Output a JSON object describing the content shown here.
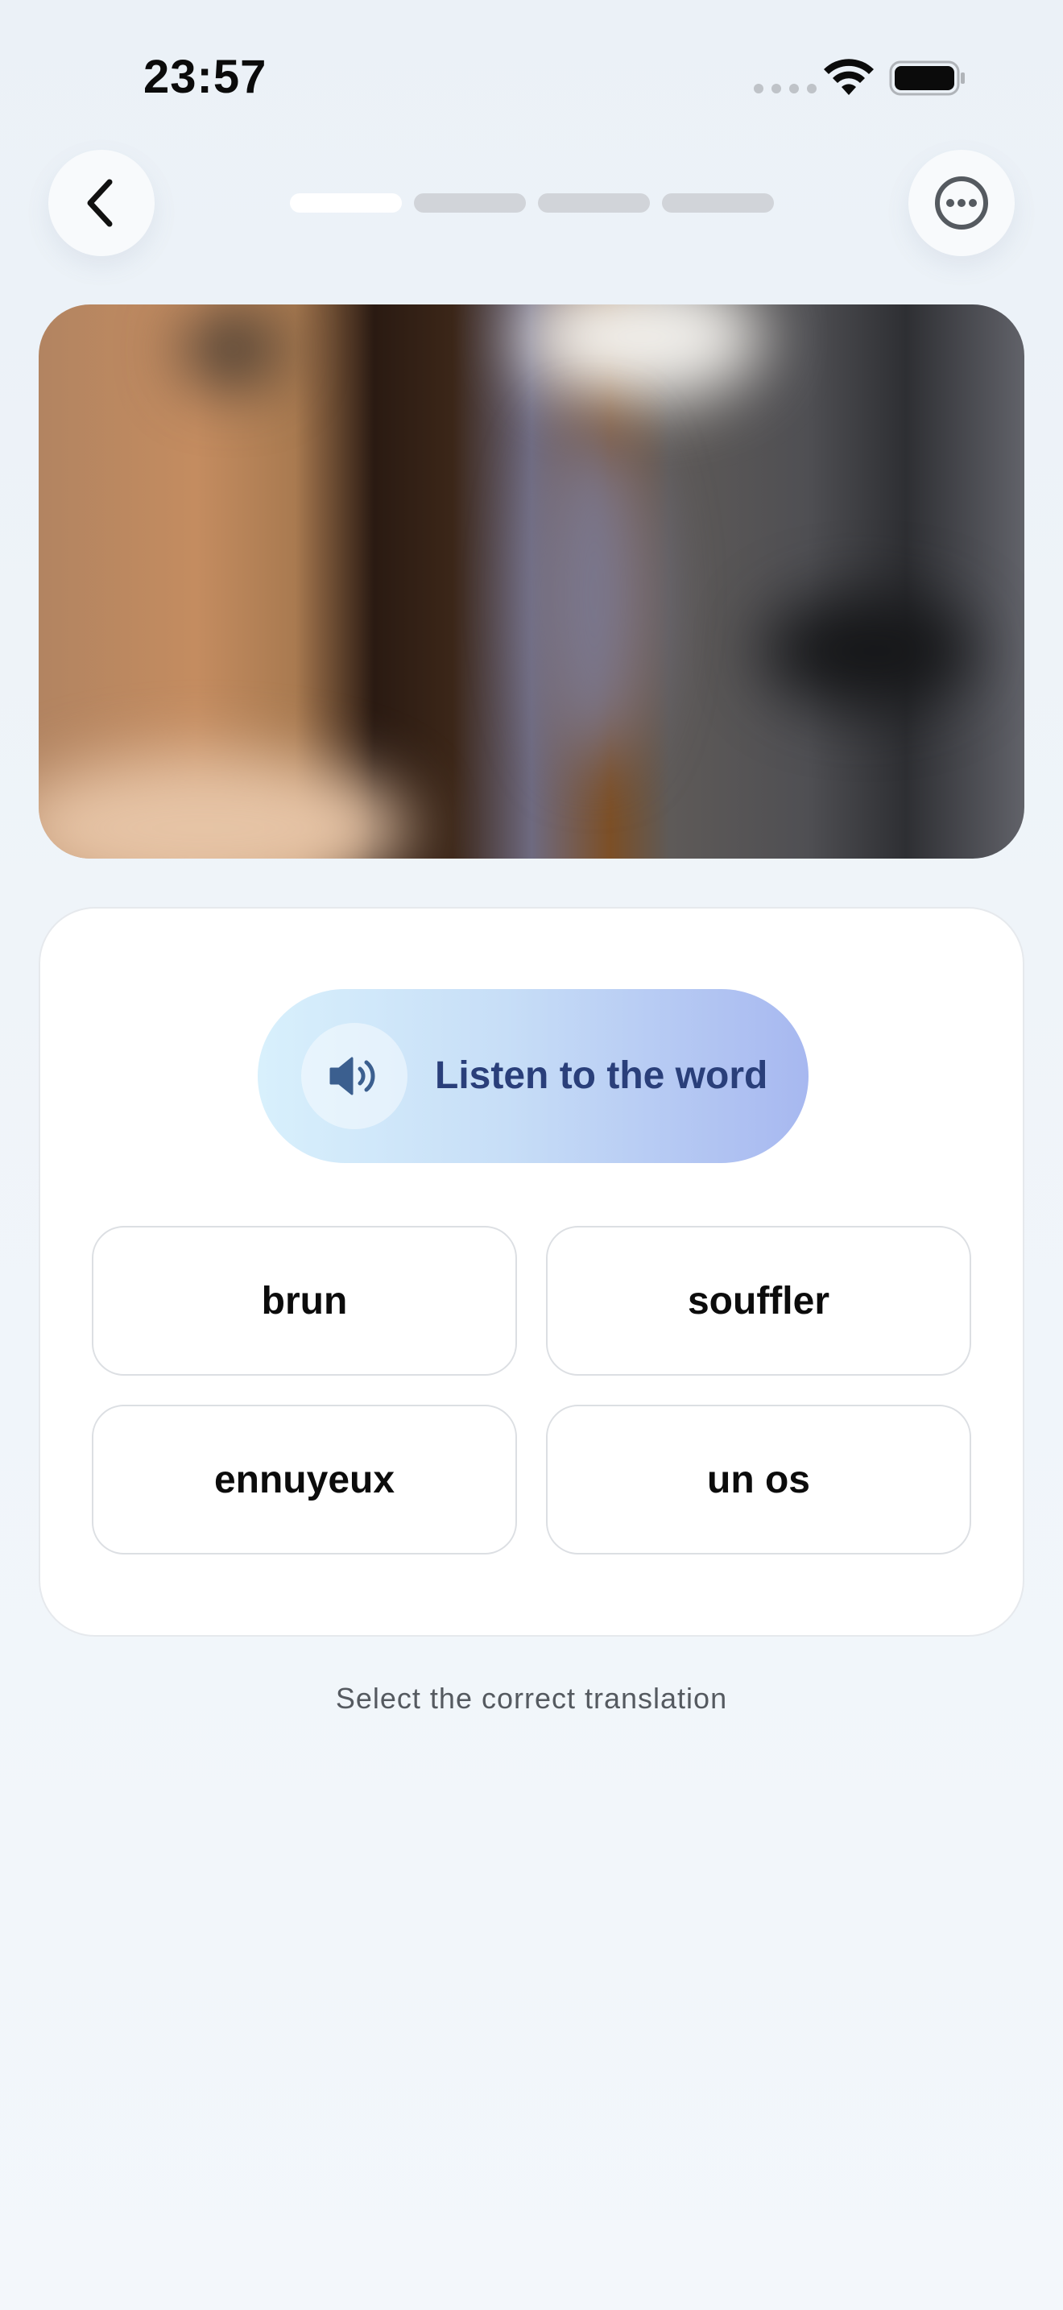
{
  "status_bar": {
    "time": "23:57",
    "icons": [
      "cellular-signal-icon",
      "wifi-icon",
      "battery-icon"
    ]
  },
  "nav": {
    "back_icon": "chevron-left-icon",
    "more_icon": "ellipsis-circle-icon",
    "progress": {
      "total_steps": 4,
      "current_step": 1
    }
  },
  "card": {
    "listen_label": "Listen to the word",
    "listen_icon": "speaker-icon",
    "options": [
      "brun",
      "souffler",
      "ennuyeux",
      "un os"
    ]
  },
  "instruction": "Select the correct translation",
  "colors": {
    "background": "#eef3f8",
    "listen_gradient_start": "#d8f0fc",
    "listen_gradient_end": "#a7b8f0",
    "listen_text": "#2a3f7a"
  }
}
